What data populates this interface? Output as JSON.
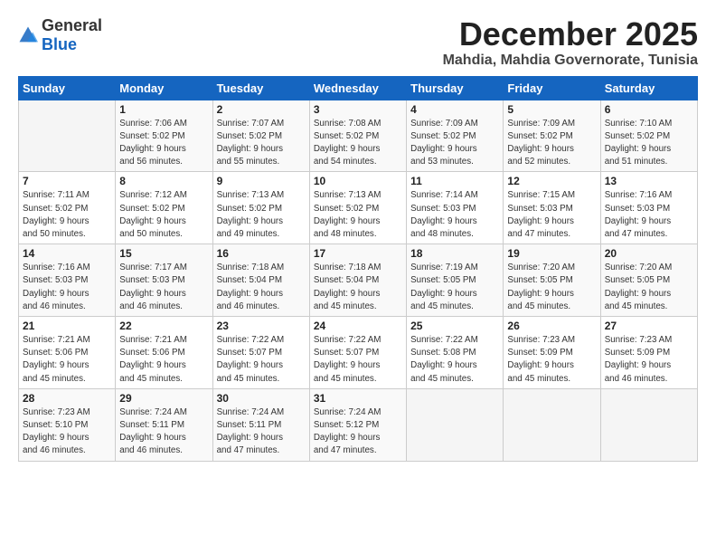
{
  "header": {
    "logo_general": "General",
    "logo_blue": "Blue",
    "title": "December 2025",
    "subtitle": "Mahdia, Mahdia Governorate, Tunisia"
  },
  "calendar": {
    "days_of_week": [
      "Sunday",
      "Monday",
      "Tuesday",
      "Wednesday",
      "Thursday",
      "Friday",
      "Saturday"
    ],
    "weeks": [
      [
        {
          "day": "",
          "info": ""
        },
        {
          "day": "1",
          "info": "Sunrise: 7:06 AM\nSunset: 5:02 PM\nDaylight: 9 hours\nand 56 minutes."
        },
        {
          "day": "2",
          "info": "Sunrise: 7:07 AM\nSunset: 5:02 PM\nDaylight: 9 hours\nand 55 minutes."
        },
        {
          "day": "3",
          "info": "Sunrise: 7:08 AM\nSunset: 5:02 PM\nDaylight: 9 hours\nand 54 minutes."
        },
        {
          "day": "4",
          "info": "Sunrise: 7:09 AM\nSunset: 5:02 PM\nDaylight: 9 hours\nand 53 minutes."
        },
        {
          "day": "5",
          "info": "Sunrise: 7:09 AM\nSunset: 5:02 PM\nDaylight: 9 hours\nand 52 minutes."
        },
        {
          "day": "6",
          "info": "Sunrise: 7:10 AM\nSunset: 5:02 PM\nDaylight: 9 hours\nand 51 minutes."
        }
      ],
      [
        {
          "day": "7",
          "info": "Sunrise: 7:11 AM\nSunset: 5:02 PM\nDaylight: 9 hours\nand 50 minutes."
        },
        {
          "day": "8",
          "info": "Sunrise: 7:12 AM\nSunset: 5:02 PM\nDaylight: 9 hours\nand 50 minutes."
        },
        {
          "day": "9",
          "info": "Sunrise: 7:13 AM\nSunset: 5:02 PM\nDaylight: 9 hours\nand 49 minutes."
        },
        {
          "day": "10",
          "info": "Sunrise: 7:13 AM\nSunset: 5:02 PM\nDaylight: 9 hours\nand 48 minutes."
        },
        {
          "day": "11",
          "info": "Sunrise: 7:14 AM\nSunset: 5:03 PM\nDaylight: 9 hours\nand 48 minutes."
        },
        {
          "day": "12",
          "info": "Sunrise: 7:15 AM\nSunset: 5:03 PM\nDaylight: 9 hours\nand 47 minutes."
        },
        {
          "day": "13",
          "info": "Sunrise: 7:16 AM\nSunset: 5:03 PM\nDaylight: 9 hours\nand 47 minutes."
        }
      ],
      [
        {
          "day": "14",
          "info": "Sunrise: 7:16 AM\nSunset: 5:03 PM\nDaylight: 9 hours\nand 46 minutes."
        },
        {
          "day": "15",
          "info": "Sunrise: 7:17 AM\nSunset: 5:03 PM\nDaylight: 9 hours\nand 46 minutes."
        },
        {
          "day": "16",
          "info": "Sunrise: 7:18 AM\nSunset: 5:04 PM\nDaylight: 9 hours\nand 46 minutes."
        },
        {
          "day": "17",
          "info": "Sunrise: 7:18 AM\nSunset: 5:04 PM\nDaylight: 9 hours\nand 45 minutes."
        },
        {
          "day": "18",
          "info": "Sunrise: 7:19 AM\nSunset: 5:05 PM\nDaylight: 9 hours\nand 45 minutes."
        },
        {
          "day": "19",
          "info": "Sunrise: 7:20 AM\nSunset: 5:05 PM\nDaylight: 9 hours\nand 45 minutes."
        },
        {
          "day": "20",
          "info": "Sunrise: 7:20 AM\nSunset: 5:05 PM\nDaylight: 9 hours\nand 45 minutes."
        }
      ],
      [
        {
          "day": "21",
          "info": "Sunrise: 7:21 AM\nSunset: 5:06 PM\nDaylight: 9 hours\nand 45 minutes."
        },
        {
          "day": "22",
          "info": "Sunrise: 7:21 AM\nSunset: 5:06 PM\nDaylight: 9 hours\nand 45 minutes."
        },
        {
          "day": "23",
          "info": "Sunrise: 7:22 AM\nSunset: 5:07 PM\nDaylight: 9 hours\nand 45 minutes."
        },
        {
          "day": "24",
          "info": "Sunrise: 7:22 AM\nSunset: 5:07 PM\nDaylight: 9 hours\nand 45 minutes."
        },
        {
          "day": "25",
          "info": "Sunrise: 7:22 AM\nSunset: 5:08 PM\nDaylight: 9 hours\nand 45 minutes."
        },
        {
          "day": "26",
          "info": "Sunrise: 7:23 AM\nSunset: 5:09 PM\nDaylight: 9 hours\nand 45 minutes."
        },
        {
          "day": "27",
          "info": "Sunrise: 7:23 AM\nSunset: 5:09 PM\nDaylight: 9 hours\nand 46 minutes."
        }
      ],
      [
        {
          "day": "28",
          "info": "Sunrise: 7:23 AM\nSunset: 5:10 PM\nDaylight: 9 hours\nand 46 minutes."
        },
        {
          "day": "29",
          "info": "Sunrise: 7:24 AM\nSunset: 5:11 PM\nDaylight: 9 hours\nand 46 minutes."
        },
        {
          "day": "30",
          "info": "Sunrise: 7:24 AM\nSunset: 5:11 PM\nDaylight: 9 hours\nand 47 minutes."
        },
        {
          "day": "31",
          "info": "Sunrise: 7:24 AM\nSunset: 5:12 PM\nDaylight: 9 hours\nand 47 minutes."
        },
        {
          "day": "",
          "info": ""
        },
        {
          "day": "",
          "info": ""
        },
        {
          "day": "",
          "info": ""
        }
      ]
    ]
  }
}
